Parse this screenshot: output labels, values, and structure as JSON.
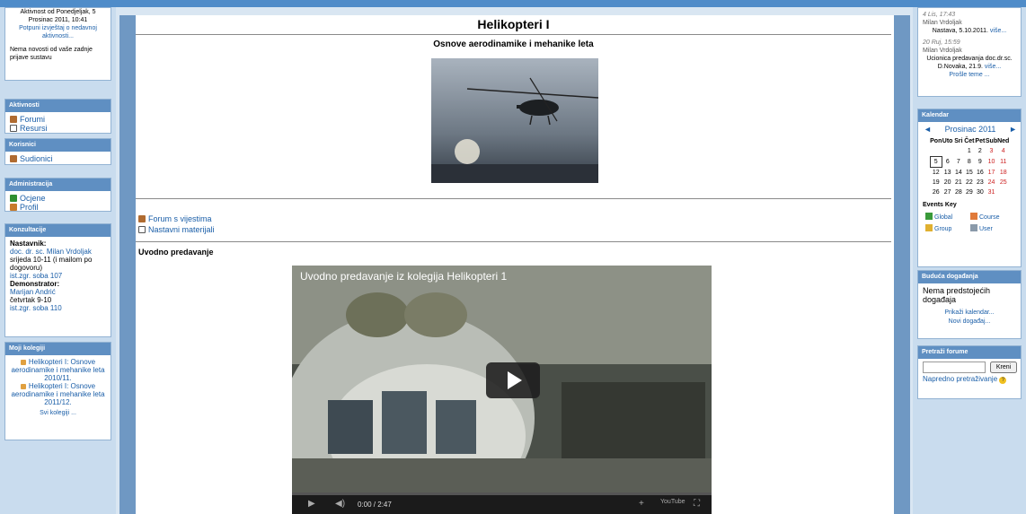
{
  "left": {
    "activity": {
      "lines": [
        "Aktivnost od Ponedjeljak, 5",
        "Prosinac 2011, 10:41"
      ],
      "report_link": "Potpuni izvještaj o nedavnoj aktivnosti...",
      "no_news": "Nema novosti od vaše zadnje prijave sustavu"
    },
    "aktivnosti": {
      "title": "Aktivnosti",
      "items": [
        "Forumi",
        "Resursi"
      ]
    },
    "korisnici": {
      "title": "Korisnici",
      "items": [
        "Sudionici"
      ]
    },
    "administracija": {
      "title": "Administracija",
      "items": [
        "Ocjene",
        "Profil"
      ]
    },
    "konzultacije": {
      "title": "Konzultacije",
      "teacher_label": "Nastavnik:",
      "teacher_name": "doc. dr. sc. Milan Vrdoljak",
      "teacher_time": "srijeda 10-11 (i mailom po dogovoru)",
      "teacher_room": "ist.zgr. soba 107",
      "demo_label": "Demonstrator:",
      "demo_name": "Marijan Andrić",
      "demo_time": "četvrtak 9-10",
      "demo_room": "ist.zgr. soba 110"
    },
    "kolegiji": {
      "title": "Moji kolegiji",
      "items": [
        "Helikopteri I: Osnove aerodinamike i mehanike leta 2010/11.",
        "Helikopteri I: Osnove aerodinamike i mehanike leta 2011/12."
      ],
      "all_link": "Svi kolegiji ..."
    }
  },
  "main": {
    "title": "Helikopteri I",
    "subtitle": "Osnove aerodinamike i mehanike leta",
    "links": [
      "Forum s vijestima",
      "Nastavni materijali"
    ],
    "section": "Uvodno predavanje",
    "video": {
      "title": "Uvodno predavanje iz kolegija Helikopteri 1",
      "time_current": "0:00",
      "time_total": "2:47",
      "progress": 0
    }
  },
  "right": {
    "news": {
      "item1_date": "4 Lis, 17:43",
      "item1_author": "Milan Vrdoljak",
      "item1_text": "Nastava, 5.10.2011.",
      "item1_more": "više...",
      "item2_date": "20 Ruj, 15:59",
      "item2_author": "Milan Vrdoljak",
      "item2_text": "Ucionica predavanja doc.dr.sc. D.Novaka, 21.9.",
      "item2_more": "više...",
      "old_topics": "Prošle teme ..."
    },
    "calendar": {
      "title": "Kalendar",
      "month": "Prosinac 2011",
      "prev": "◄",
      "next": "►",
      "weekdays": [
        "Pon",
        "Uto",
        "Sri",
        "Čet",
        "Pet",
        "Sub",
        "Ned"
      ],
      "weeks": [
        [
          "",
          "",
          "",
          "1",
          "2",
          "3",
          "4"
        ],
        [
          "5",
          "6",
          "7",
          "8",
          "9",
          "10",
          "11"
        ],
        [
          "12",
          "13",
          "14",
          "15",
          "16",
          "17",
          "18"
        ],
        [
          "19",
          "20",
          "21",
          "22",
          "23",
          "24",
          "25"
        ],
        [
          "26",
          "27",
          "28",
          "29",
          "30",
          "31",
          ""
        ]
      ],
      "today": "5",
      "events_key": "Events Key",
      "keys": [
        "Global",
        "Course",
        "Group",
        "User"
      ]
    },
    "upcoming": {
      "title": "Buduća događanja",
      "none": "Nema predstojećih događaja",
      "show_cal": "Prikaži kalendar...",
      "new_event": "Novi događaj..."
    },
    "search": {
      "title": "Pretraži forume",
      "button": "Kreni",
      "placeholder": "",
      "advanced": "Napredno pretraživanje"
    }
  }
}
